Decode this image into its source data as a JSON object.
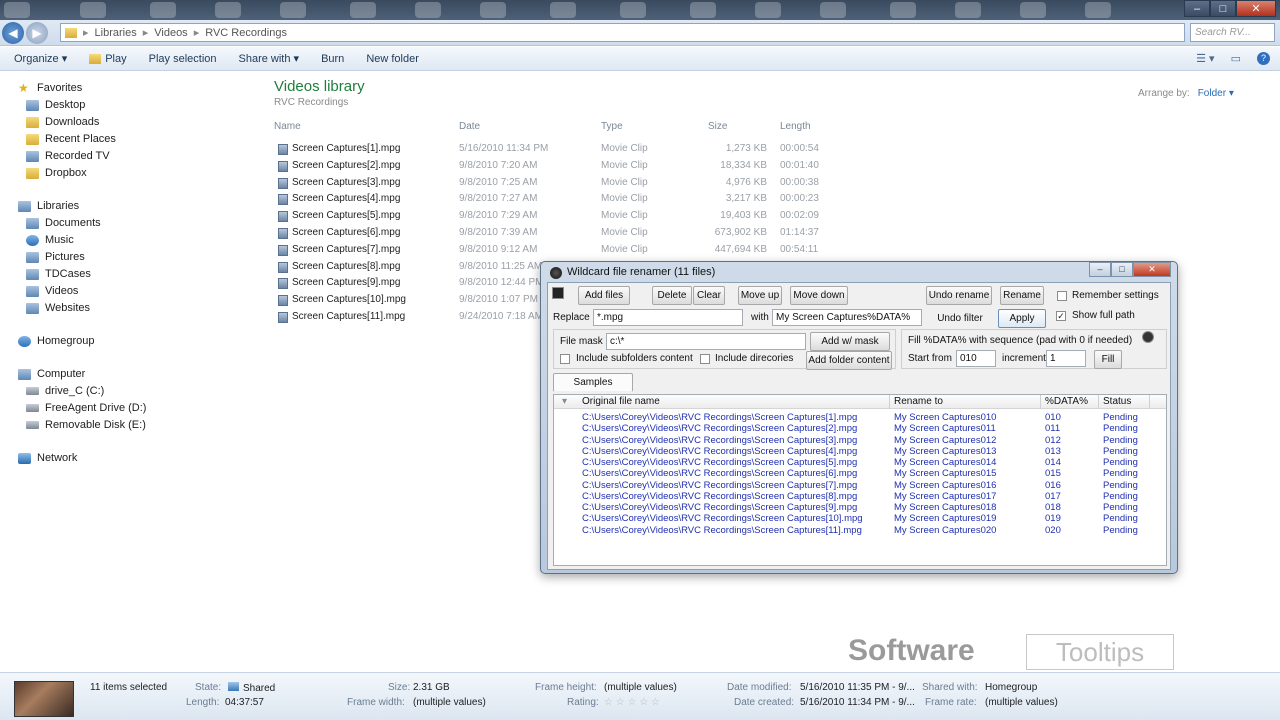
{
  "window": {
    "minimize_glyph": "–",
    "maximize_glyph": "□",
    "close_glyph": "✕"
  },
  "address": {
    "segments": [
      "Libraries",
      "Videos",
      "RVC Recordings"
    ],
    "search_placeholder": "Search RV..."
  },
  "commands": {
    "organize": "Organize ▾",
    "play": "Play",
    "play_selection": "Play selection",
    "share_with": "Share with ▾",
    "burn": "Burn",
    "new_folder": "New folder"
  },
  "nav": {
    "favorites": "Favorites",
    "desktop": "Desktop",
    "downloads": "Downloads",
    "recent_places": "Recent Places",
    "recorded_tv": "Recorded TV",
    "dropbox": "Dropbox",
    "libraries": "Libraries",
    "documents": "Documents",
    "music": "Music",
    "pictures": "Pictures",
    "tdcases": "TDCases",
    "videos": "Videos",
    "websites": "Websites",
    "homegroup": "Homegroup",
    "computer": "Computer",
    "drive_c": "drive_C (C:)",
    "freeagent": "FreeAgent Drive (D:)",
    "removable": "Removable Disk (E:)",
    "network": "Network"
  },
  "library": {
    "title": "Videos library",
    "subtitle": "RVC Recordings",
    "arrange_by": "Arrange by:",
    "arrange_value": "Folder ▾"
  },
  "columns": {
    "name": "Name",
    "date": "Date",
    "type": "Type",
    "size": "Size",
    "length": "Length"
  },
  "files": [
    {
      "name": "Screen Captures[1].mpg",
      "date": "5/16/2010 11:34 PM",
      "type": "Movie Clip",
      "size": "1,273 KB",
      "length": "00:00:54"
    },
    {
      "name": "Screen Captures[2].mpg",
      "date": "9/8/2010 7:20 AM",
      "type": "Movie Clip",
      "size": "18,334 KB",
      "length": "00:01:40"
    },
    {
      "name": "Screen Captures[3].mpg",
      "date": "9/8/2010 7:25 AM",
      "type": "Movie Clip",
      "size": "4,976 KB",
      "length": "00:00:38"
    },
    {
      "name": "Screen Captures[4].mpg",
      "date": "9/8/2010 7:27 AM",
      "type": "Movie Clip",
      "size": "3,217 KB",
      "length": "00:00:23"
    },
    {
      "name": "Screen Captures[5].mpg",
      "date": "9/8/2010 7:29 AM",
      "type": "Movie Clip",
      "size": "19,403 KB",
      "length": "00:02:09"
    },
    {
      "name": "Screen Captures[6].mpg",
      "date": "9/8/2010 7:39 AM",
      "type": "Movie Clip",
      "size": "673,902 KB",
      "length": "01:14:37"
    },
    {
      "name": "Screen Captures[7].mpg",
      "date": "9/8/2010 9:12 AM",
      "type": "Movie Clip",
      "size": "447,694 KB",
      "length": "00:54:11"
    },
    {
      "name": "Screen Captures[8].mpg",
      "date": "9/8/2010 11:25 AM",
      "type": "",
      "size": "",
      "length": ""
    },
    {
      "name": "Screen Captures[9].mpg",
      "date": "9/8/2010 12:44 PM",
      "type": "",
      "size": "",
      "length": ""
    },
    {
      "name": "Screen Captures[10].mpg",
      "date": "9/8/2010 1:07 PM",
      "type": "",
      "size": "",
      "length": ""
    },
    {
      "name": "Screen Captures[11].mpg",
      "date": "9/24/2010 7:18 AM",
      "type": "",
      "size": "",
      "length": ""
    }
  ],
  "dialog": {
    "title": "Wildcard file renamer (11 files)",
    "add_files": "Add files",
    "delete": "Delete",
    "clear": "Clear",
    "move_up": "Move up",
    "move_down": "Move down",
    "undo_rename": "Undo rename",
    "rename": "Rename",
    "remember_settings": "Remember settings",
    "replace_label": "Replace",
    "replace_value": "*.mpg",
    "with_label": "with",
    "with_value": "My Screen Captures%DATA%",
    "undo_filter": "Undo filter",
    "apply": "Apply",
    "show_full_path": "Show full path",
    "file_mask_label": "File mask",
    "file_mask_value": "c:\\*",
    "add_w_mask": "Add w/ mask",
    "include_subfolders": "Include subfolders content",
    "include_directories": "Include direcories",
    "add_folder_content": "Add folder content",
    "fill_label": "Fill %DATA% with sequence (pad with 0 if needed)",
    "start_from_label": "Start from",
    "start_from_value": "010",
    "increment_label": "increment",
    "increment_value": "1",
    "fill": "Fill",
    "samples": "Samples",
    "col_original": "Original file name",
    "col_rename": "Rename to",
    "col_data": "%DATA%",
    "col_status": "Status",
    "rows": [
      {
        "orig": "C:\\Users\\Corey\\Videos\\RVC Recordings\\Screen Captures[1].mpg",
        "rename": "My Screen Captures010",
        "data": "010",
        "status": "Pending"
      },
      {
        "orig": "C:\\Users\\Corey\\Videos\\RVC Recordings\\Screen Captures[2].mpg",
        "rename": "My Screen Captures011",
        "data": "011",
        "status": "Pending"
      },
      {
        "orig": "C:\\Users\\Corey\\Videos\\RVC Recordings\\Screen Captures[3].mpg",
        "rename": "My Screen Captures012",
        "data": "012",
        "status": "Pending"
      },
      {
        "orig": "C:\\Users\\Corey\\Videos\\RVC Recordings\\Screen Captures[4].mpg",
        "rename": "My Screen Captures013",
        "data": "013",
        "status": "Pending"
      },
      {
        "orig": "C:\\Users\\Corey\\Videos\\RVC Recordings\\Screen Captures[5].mpg",
        "rename": "My Screen Captures014",
        "data": "014",
        "status": "Pending"
      },
      {
        "orig": "C:\\Users\\Corey\\Videos\\RVC Recordings\\Screen Captures[6].mpg",
        "rename": "My Screen Captures015",
        "data": "015",
        "status": "Pending"
      },
      {
        "orig": "C:\\Users\\Corey\\Videos\\RVC Recordings\\Screen Captures[7].mpg",
        "rename": "My Screen Captures016",
        "data": "016",
        "status": "Pending"
      },
      {
        "orig": "C:\\Users\\Corey\\Videos\\RVC Recordings\\Screen Captures[8].mpg",
        "rename": "My Screen Captures017",
        "data": "017",
        "status": "Pending"
      },
      {
        "orig": "C:\\Users\\Corey\\Videos\\RVC Recordings\\Screen Captures[9].mpg",
        "rename": "My Screen Captures018",
        "data": "018",
        "status": "Pending"
      },
      {
        "orig": "C:\\Users\\Corey\\Videos\\RVC Recordings\\Screen Captures[10].mpg",
        "rename": "My Screen Captures019",
        "data": "019",
        "status": "Pending"
      },
      {
        "orig": "C:\\Users\\Corey\\Videos\\RVC Recordings\\Screen Captures[11].mpg",
        "rename": "My Screen Captures020",
        "data": "020",
        "status": "Pending"
      }
    ]
  },
  "watermark": {
    "left": "Software",
    "right": "Tooltips"
  },
  "details": {
    "count": "11 items selected",
    "state_label": "State:",
    "state_value": "Shared",
    "length_label": "Length:",
    "length_value": "04:37:57",
    "size_label": "Size:",
    "size_value": "2.31 GB",
    "frame_width_label": "Frame width:",
    "frame_width_value": "(multiple values)",
    "frame_height_label": "Frame height:",
    "frame_height_value": "(multiple values)",
    "rating_label": "Rating:",
    "rating_value": "☆ ☆ ☆ ☆ ☆",
    "date_modified_label": "Date modified:",
    "date_modified_value": "5/16/2010 11:35 PM - 9/...",
    "date_created_label": "Date created:",
    "date_created_value": "5/16/2010 11:34 PM - 9/...",
    "shared_with_label": "Shared with:",
    "shared_with_value": "Homegroup",
    "frame_rate_label": "Frame rate:",
    "frame_rate_value": "(multiple values)"
  }
}
